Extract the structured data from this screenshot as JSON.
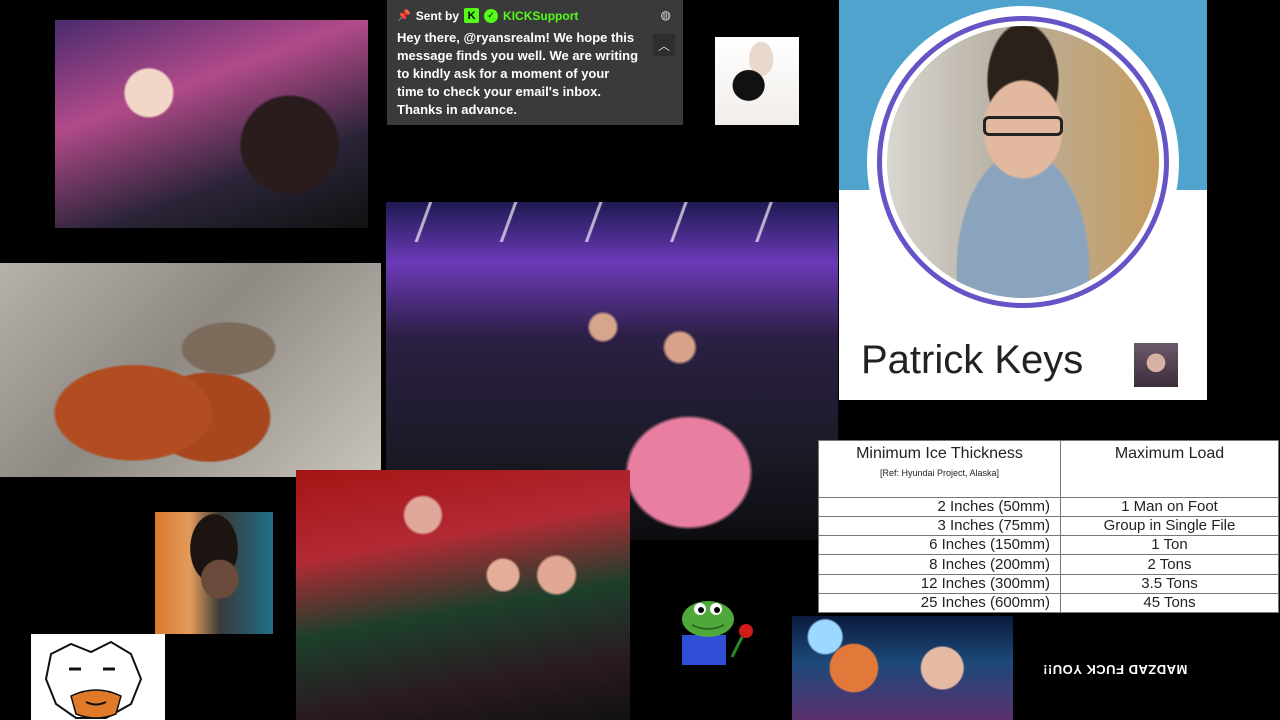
{
  "kick_message": {
    "sent_by_label": "Sent by",
    "sender_name": "KICKSupport",
    "logo_letter": "K",
    "message": "Hey there, @ryansrealm! We hope this message finds you well. We are writing to kindly ask for a moment of your time to check your email's inbox. Thanks in advance.",
    "accent_color": "#53fc18"
  },
  "profile_card": {
    "name": "Patrick Keys",
    "ring_color": "#6454c6",
    "banner_color": "#4fa3cd"
  },
  "ice_table": {
    "headers": {
      "thickness": "Minimum Ice Thickness",
      "thickness_ref": "[Ref: Hyundai Project, Alaska]",
      "load": "Maximum Load"
    },
    "rows": [
      {
        "thickness": "2 Inches (50mm)",
        "load": "1 Man on Foot"
      },
      {
        "thickness": "3 Inches (75mm)",
        "load": "Group in Single File"
      },
      {
        "thickness": "6 Inches (150mm)",
        "load": "1 Ton"
      },
      {
        "thickness": "8 Inches (200mm)",
        "load": "2 Tons"
      },
      {
        "thickness": "12 Inches (300mm)",
        "load": "3.5 Tons"
      },
      {
        "thickness": "25 Inches (600mm)",
        "load": "45 Tons"
      }
    ]
  },
  "caption_flipped": "MADZAD FUCK YOU!!"
}
